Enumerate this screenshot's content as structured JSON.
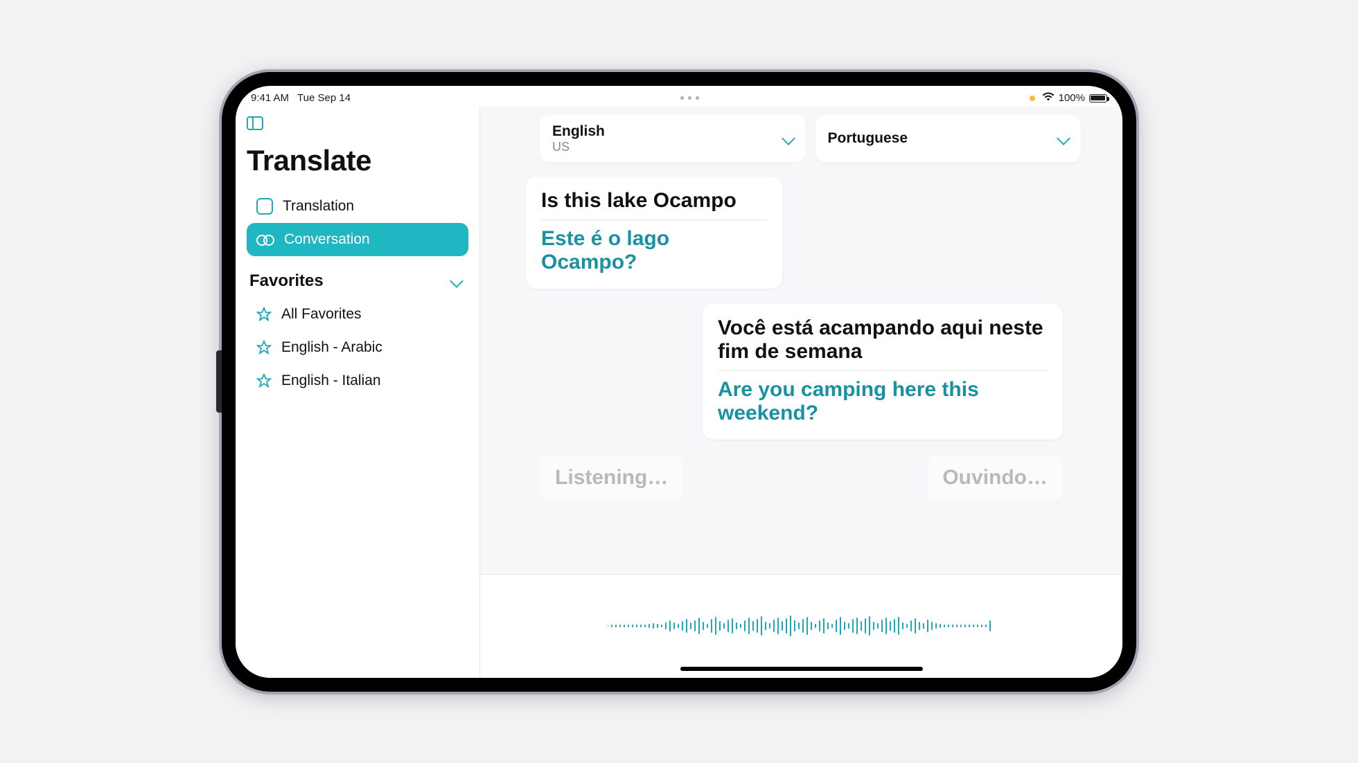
{
  "status": {
    "time": "9:41 AM",
    "date": "Tue Sep 14",
    "battery_pct": "100%"
  },
  "sidebar": {
    "title": "Translate",
    "nav": {
      "translation_label": "Translation",
      "conversation_label": "Conversation"
    },
    "favorites_header": "Favorites",
    "favorites": [
      {
        "label": "All Favorites"
      },
      {
        "label": "English - Arabic"
      },
      {
        "label": "English - Italian"
      }
    ]
  },
  "languages": {
    "source": {
      "name": "English",
      "region": "US"
    },
    "target": {
      "name": "Portuguese",
      "region": ""
    }
  },
  "conversation": [
    {
      "side": "left",
      "source_text": "Is this lake Ocampo",
      "target_text": "Este é o lago Ocampo?"
    },
    {
      "side": "right",
      "source_text": "Você está acampando aqui neste fim de semana",
      "target_text": "Are you camping here this weekend?"
    }
  ],
  "listening": {
    "left_label": "Listening…",
    "right_label": "Ouvindo…"
  }
}
